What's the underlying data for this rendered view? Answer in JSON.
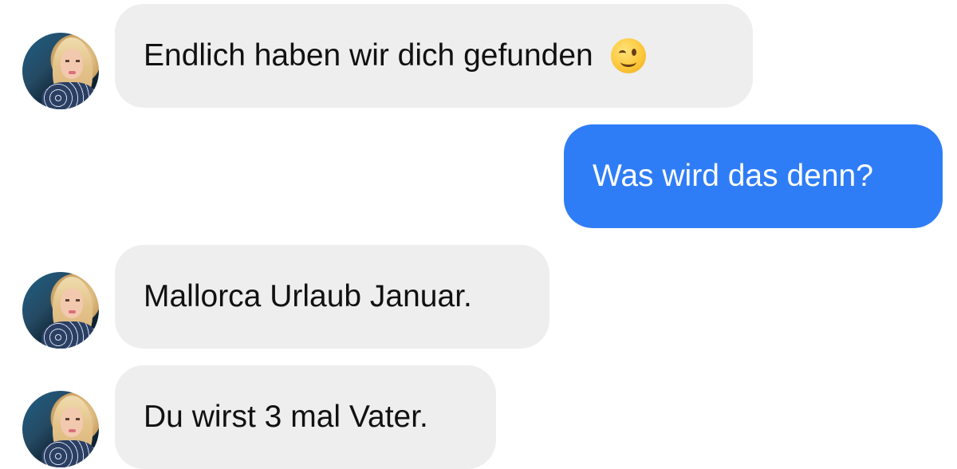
{
  "conversation": {
    "messages": [
      {
        "side": "incoming",
        "text": "Endlich haben wir dich gefunden",
        "emoji": "winking-face-icon"
      },
      {
        "side": "outgoing",
        "text": "Was wird das denn?"
      },
      {
        "side": "incoming",
        "text": "Mallorca Urlaub Januar."
      },
      {
        "side": "incoming",
        "text": "Du wirst 3 mal Vater."
      }
    ]
  },
  "colors": {
    "incoming_bubble": "#eeeeee",
    "outgoing_bubble": "#2f7df6",
    "incoming_text": "#111111",
    "outgoing_text": "#ffffff"
  }
}
